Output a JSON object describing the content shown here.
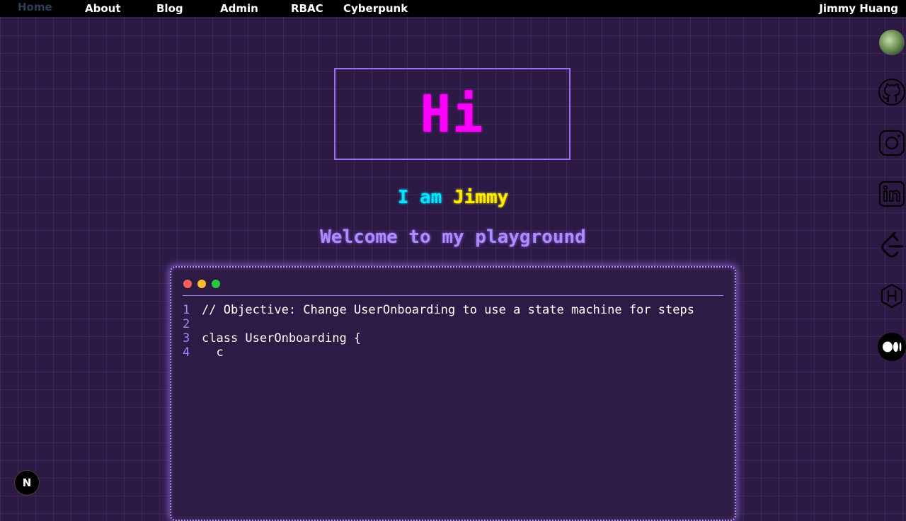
{
  "nav": {
    "items": [
      {
        "label": "Home",
        "active": true
      },
      {
        "label": "About"
      },
      {
        "label": "Blog"
      },
      {
        "label": "Admin"
      },
      {
        "label": "RBAC"
      },
      {
        "label": "Cyberpunk"
      }
    ],
    "user_name": "Jimmy Huang"
  },
  "hero": {
    "greeting": "Hi",
    "intro_part1": "I am",
    "intro_name": "Jimmy",
    "welcome": "Welcome to my playground"
  },
  "terminal": {
    "dots": [
      "#ff5f56",
      "#ffbd2e",
      "#27c93f"
    ],
    "lines": [
      {
        "num": "1",
        "text": "// Objective: Change UserOnboarding to use a state machine for steps"
      },
      {
        "num": "2",
        "text": ""
      },
      {
        "num": "3",
        "text": "class UserOnboarding {"
      },
      {
        "num": "4",
        "text": "  c"
      }
    ]
  },
  "social_icons": [
    "avatar-icon",
    "github-icon",
    "instagram-icon",
    "linkedin-icon",
    "leetcode-icon",
    "hackerrank-icon",
    "medium-icon"
  ],
  "badge": {
    "label": "N"
  },
  "colors": {
    "background": "#2c1a45",
    "neon_pink": "#ff00ff",
    "neon_cyan": "#00e5ff",
    "neon_yellow": "#ffee00",
    "neon_purple": "#b08cff"
  }
}
